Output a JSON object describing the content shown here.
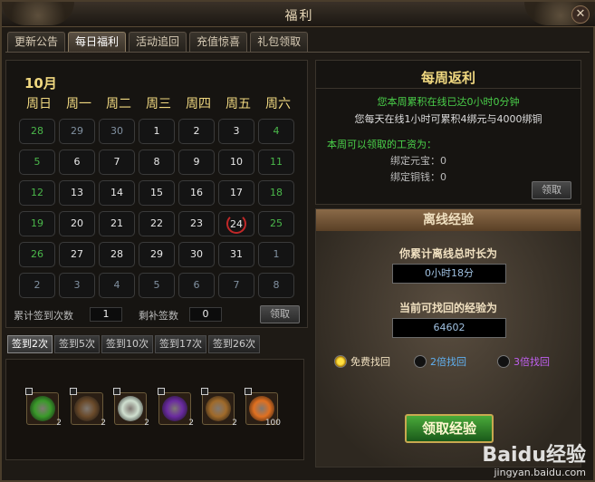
{
  "window": {
    "title": "福利",
    "close_glyph": "✕"
  },
  "tabs": [
    {
      "label": "更新公告"
    },
    {
      "label": "每日福利",
      "active": true
    },
    {
      "label": "活动追回"
    },
    {
      "label": "充值惊喜"
    },
    {
      "label": "礼包领取"
    }
  ],
  "calendar": {
    "month": "10月",
    "weekdays": [
      "周日",
      "周一",
      "周二",
      "周三",
      "周四",
      "周五",
      "周六"
    ],
    "days": [
      {
        "n": "28",
        "k": "wk"
      },
      {
        "n": "29",
        "k": "other"
      },
      {
        "n": "30",
        "k": "other"
      },
      {
        "n": "1",
        "k": ""
      },
      {
        "n": "2",
        "k": ""
      },
      {
        "n": "3",
        "k": ""
      },
      {
        "n": "4",
        "k": "wk"
      },
      {
        "n": "5",
        "k": "wk"
      },
      {
        "n": "6",
        "k": ""
      },
      {
        "n": "7",
        "k": ""
      },
      {
        "n": "8",
        "k": ""
      },
      {
        "n": "9",
        "k": ""
      },
      {
        "n": "10",
        "k": ""
      },
      {
        "n": "11",
        "k": "wk"
      },
      {
        "n": "12",
        "k": "wk"
      },
      {
        "n": "13",
        "k": ""
      },
      {
        "n": "14",
        "k": ""
      },
      {
        "n": "15",
        "k": ""
      },
      {
        "n": "16",
        "k": ""
      },
      {
        "n": "17",
        "k": ""
      },
      {
        "n": "18",
        "k": "wk"
      },
      {
        "n": "19",
        "k": "wk"
      },
      {
        "n": "20",
        "k": ""
      },
      {
        "n": "21",
        "k": ""
      },
      {
        "n": "22",
        "k": ""
      },
      {
        "n": "23",
        "k": ""
      },
      {
        "n": "24",
        "k": "today"
      },
      {
        "n": "25",
        "k": "wk"
      },
      {
        "n": "26",
        "k": "wk"
      },
      {
        "n": "27",
        "k": ""
      },
      {
        "n": "28",
        "k": ""
      },
      {
        "n": "29",
        "k": ""
      },
      {
        "n": "30",
        "k": ""
      },
      {
        "n": "31",
        "k": ""
      },
      {
        "n": "1",
        "k": "other"
      },
      {
        "n": "2",
        "k": "other"
      },
      {
        "n": "3",
        "k": "other"
      },
      {
        "n": "4",
        "k": "other"
      },
      {
        "n": "5",
        "k": "other"
      },
      {
        "n": "6",
        "k": "other"
      },
      {
        "n": "7",
        "k": "other"
      },
      {
        "n": "8",
        "k": "other"
      }
    ],
    "total_label": "累计签到次数",
    "total_value": "1",
    "makeup_label": "剩补签数",
    "makeup_value": "0",
    "claim_label": "领取"
  },
  "signin_tabs": [
    {
      "label": "签到2次",
      "active": true
    },
    {
      "label": "签到5次"
    },
    {
      "label": "签到10次"
    },
    {
      "label": "签到17次"
    },
    {
      "label": "签到26次"
    }
  ],
  "rewards": [
    {
      "icon": "green-orb-icon",
      "count": "2",
      "color": "#3a9a2a"
    },
    {
      "icon": "bow-icon",
      "count": "2",
      "color": "#6a4a2a"
    },
    {
      "icon": "lotus-icon",
      "count": "2",
      "color": "#d0e0d0"
    },
    {
      "icon": "purple-gem-icon",
      "count": "2",
      "color": "#6a2aa0"
    },
    {
      "icon": "pouch-icon",
      "count": "2",
      "color": "#a06a2a"
    },
    {
      "icon": "fire-orb-icon",
      "count": "100",
      "color": "#e07020"
    }
  ],
  "weekly": {
    "title": "每周返利",
    "line1": "您本周累积在线已达0小时0分钟",
    "line2": "您每天在线1小时可累积4绑元与4000绑铜",
    "line3": "本周可以领取的工资为：",
    "line4": "绑定元宝：0",
    "line5": "绑定铜钱：0",
    "claim_label": "领取"
  },
  "offline": {
    "title": "离线经验",
    "total_label": "你累计离线总时长为",
    "total_value": "0小时18分",
    "exp_label": "当前可找回的经验为",
    "exp_value": "64602",
    "options": [
      {
        "label": "免费找回",
        "color": "#f0e0c0",
        "selected": true
      },
      {
        "label": "2倍找回",
        "color": "#60b0f0",
        "selected": false
      },
      {
        "label": "3倍找回",
        "color": "#c060f0",
        "selected": false
      }
    ],
    "collect_label": "领取经验"
  },
  "watermark": {
    "brand": "Baidu经验",
    "url": "jingyan.baidu.com"
  }
}
